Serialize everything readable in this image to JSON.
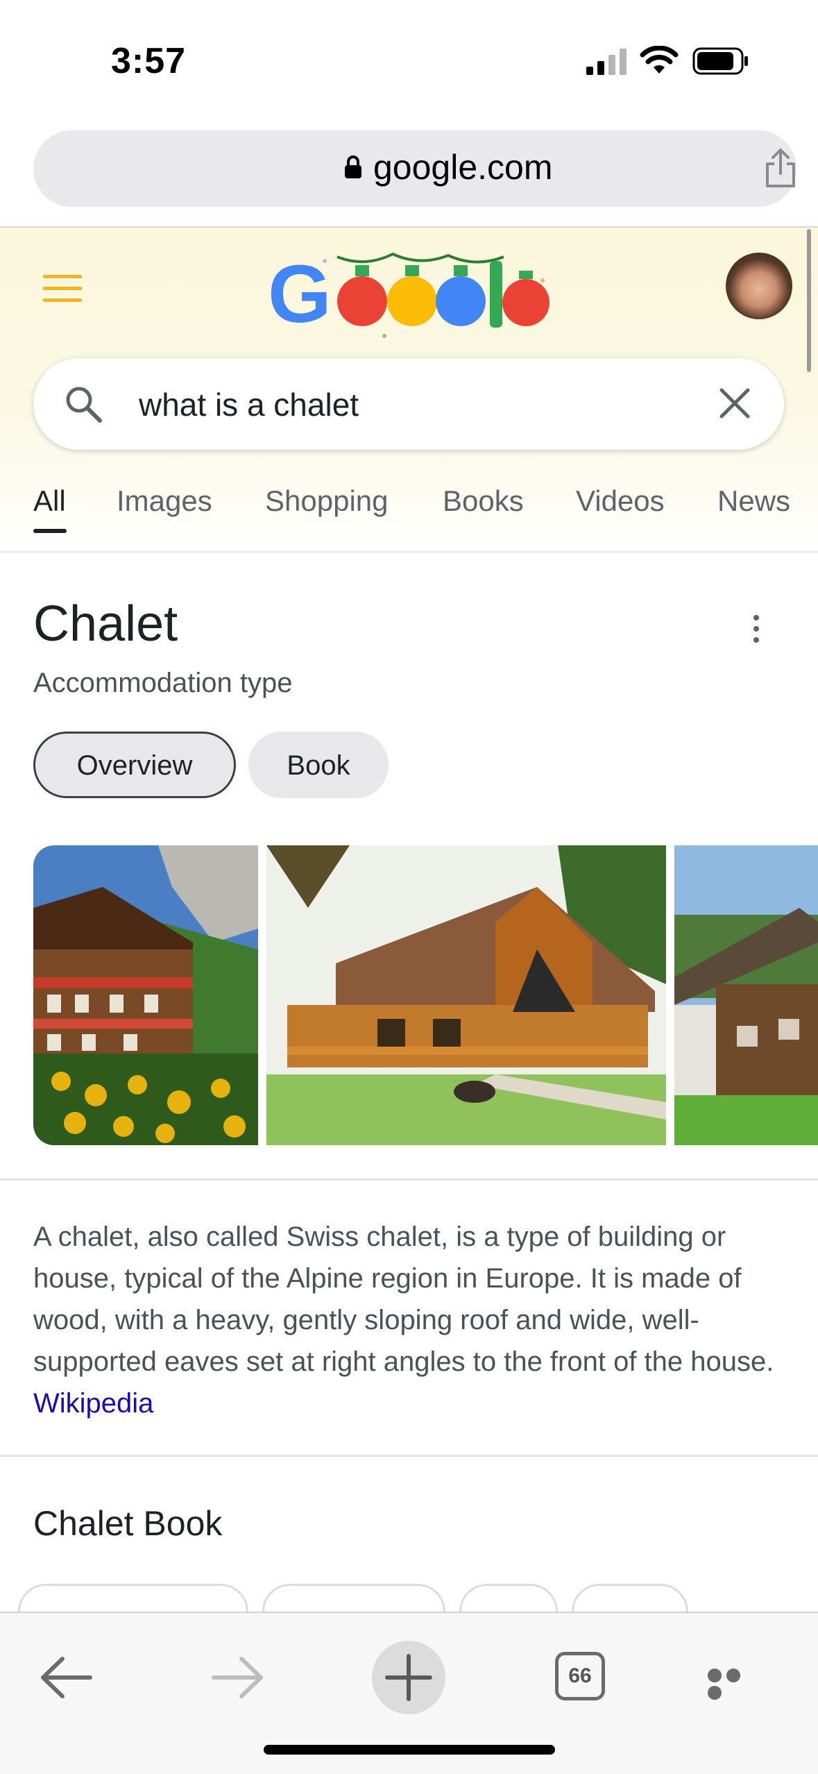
{
  "status_bar": {
    "time": "3:57"
  },
  "browser": {
    "url": "google.com",
    "open_tabs_count": "66"
  },
  "search": {
    "query": "what is a chalet"
  },
  "tabs": [
    "All",
    "Images",
    "Shopping",
    "Books",
    "Videos",
    "News"
  ],
  "active_tab": "All",
  "knowledge_panel": {
    "title": "Chalet",
    "subtitle": "Accommodation type",
    "chips": {
      "overview": "Overview",
      "book": "Book"
    },
    "description": "A chalet, also called Swiss chalet, is a type of building or house, typical of the Alpine region in Europe. It is made of wood, with a heavy, gently sloping roof and wide, well-supported eaves set at right angles to the front of the house.",
    "source_link": "Wikipedia"
  },
  "section": {
    "title": "Chalet Book"
  },
  "colors": {
    "google_blue": "#4285f4",
    "google_red": "#ea4335",
    "google_yellow": "#fbbc05",
    "google_green": "#34a853",
    "menu_yellow": "#f0b429",
    "link_blue": "#1a0dab"
  },
  "icons": [
    "lock-icon",
    "share-icon",
    "menu-icon",
    "search-icon",
    "clear-icon",
    "more-vert-icon",
    "back-arrow-icon",
    "forward-arrow-icon",
    "plus-icon",
    "tabs-icon",
    "more-horiz-icon"
  ]
}
